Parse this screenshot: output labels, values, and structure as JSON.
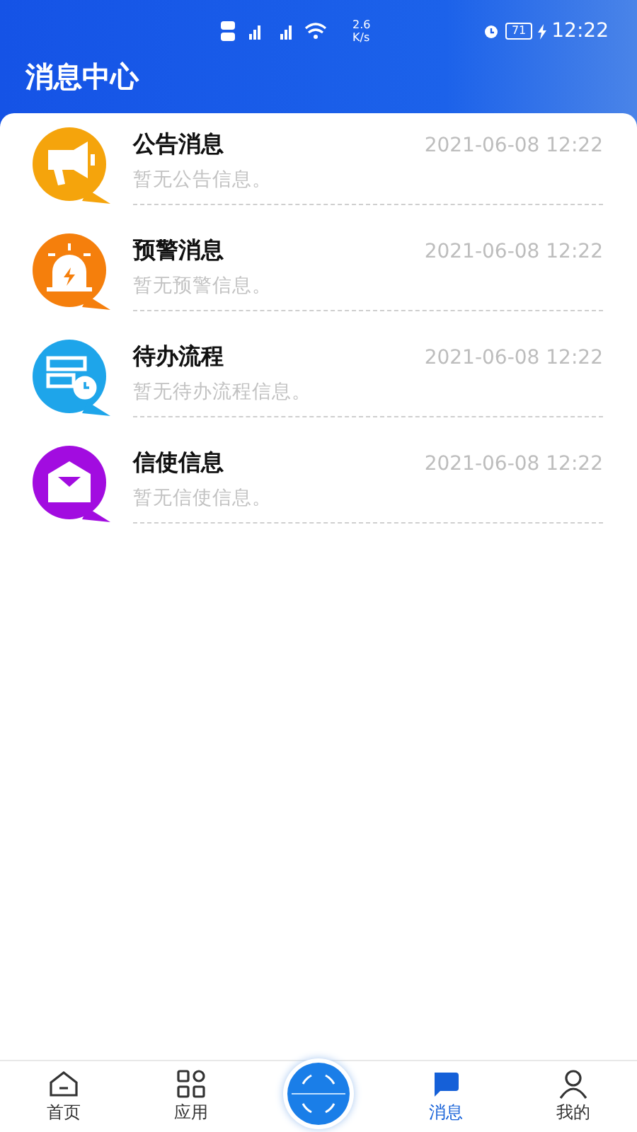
{
  "status_bar": {
    "speed": "2.6",
    "speed_unit": "K/s",
    "battery": "71",
    "time": "12:22"
  },
  "header": {
    "title": "消息中心"
  },
  "messages": [
    {
      "kind": "announcement",
      "color": "#f5a40c",
      "title": "公告消息",
      "time": "2021-06-08 12:22",
      "preview": "暂无公告信息。"
    },
    {
      "kind": "warning",
      "color": "#f57f0c",
      "title": "预警消息",
      "time": "2021-06-08 12:22",
      "preview": "暂无预警信息。"
    },
    {
      "kind": "workflow",
      "color": "#1ea5ea",
      "title": "待办流程",
      "time": "2021-06-08 12:22",
      "preview": "暂无待办流程信息。"
    },
    {
      "kind": "mail",
      "color": "#a20ce0",
      "title": "信使信息",
      "time": "2021-06-08 12:22",
      "preview": "暂无信使信息。"
    }
  ],
  "tabs": [
    {
      "kind": "home",
      "label": "首页",
      "selected": false
    },
    {
      "kind": "apps",
      "label": "应用",
      "selected": false
    },
    {
      "kind": "center",
      "selected": false
    },
    {
      "kind": "messages",
      "label": "消息",
      "selected": true
    },
    {
      "kind": "profile",
      "label": "我的",
      "selected": false
    }
  ]
}
